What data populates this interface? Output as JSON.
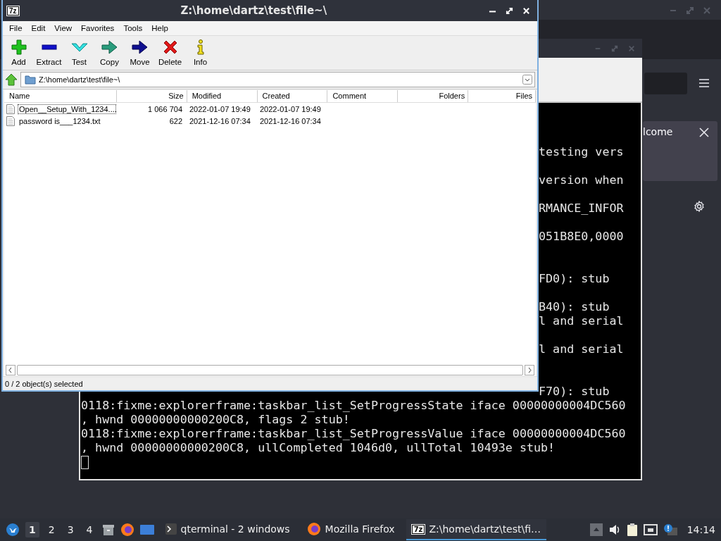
{
  "browser": {
    "notification": "lcome"
  },
  "terminal": {
    "output_fragments": "testing vers\n\nversion when\n\nRMANCE_INFOR\n\n051B8E0,0000\n\n\nFD0): stub\n\nB40): stub\nl and serial\n\nl and serial\n\n\nF70): stub",
    "output": "0118:fixme:explorerframe:taskbar_list_SetProgressState iface 00000000004DC560\n, hwnd 00000000000200C8, flags 2 stub!\n0118:fixme:explorerframe:taskbar_list_SetProgressValue iface 00000000004DC560\n, hwnd 00000000000200C8, ullCompleted 1046d0, ullTotal 10493e stub!"
  },
  "archive_window": {
    "app_badge": "7z",
    "title": "Z:\\home\\dartz\\test\\file~\\",
    "menu": [
      "File",
      "Edit",
      "View",
      "Favorites",
      "Tools",
      "Help"
    ],
    "toolbar": [
      {
        "label": "Add",
        "kind": "add"
      },
      {
        "label": "Extract",
        "kind": "extract"
      },
      {
        "label": "Test",
        "kind": "test"
      },
      {
        "label": "Copy",
        "kind": "copy"
      },
      {
        "label": "Move",
        "kind": "move"
      },
      {
        "label": "Delete",
        "kind": "delete"
      },
      {
        "label": "Info",
        "kind": "info"
      }
    ],
    "path": "Z:\\home\\dartz\\test\\file~\\",
    "columns": [
      "Name",
      "Size",
      "Modified",
      "Created",
      "Comment",
      "Folders",
      "Files"
    ],
    "rows": [
      {
        "name": "Open__Setup_With_1234....",
        "size": "1 066 704",
        "modified": "2022-01-07 19:49",
        "created": "2022-01-07 19:49",
        "focused": true,
        "selected": false
      },
      {
        "name": "password is___1234.txt",
        "size": "622",
        "modified": "2021-12-16 07:34",
        "created": "2021-12-16 07:34",
        "focused": false,
        "selected": false
      }
    ],
    "status": "0 / 2 object(s) selected"
  },
  "taskbar": {
    "desktops": [
      {
        "label": "1",
        "selected": true
      },
      {
        "label": "2",
        "selected": false
      },
      {
        "label": "3",
        "selected": false
      },
      {
        "label": "4",
        "selected": false
      }
    ],
    "tasks": [
      {
        "label": "qterminal - 2 windows",
        "kind": "terminal",
        "selected": false
      },
      {
        "label": "Mozilla Firefox",
        "kind": "firefox",
        "selected": false
      },
      {
        "label": "Z:\\home\\dartz\\test\\fi…",
        "kind": "archiver",
        "badge": "7z",
        "selected": true
      }
    ],
    "clock": "14:14"
  }
}
